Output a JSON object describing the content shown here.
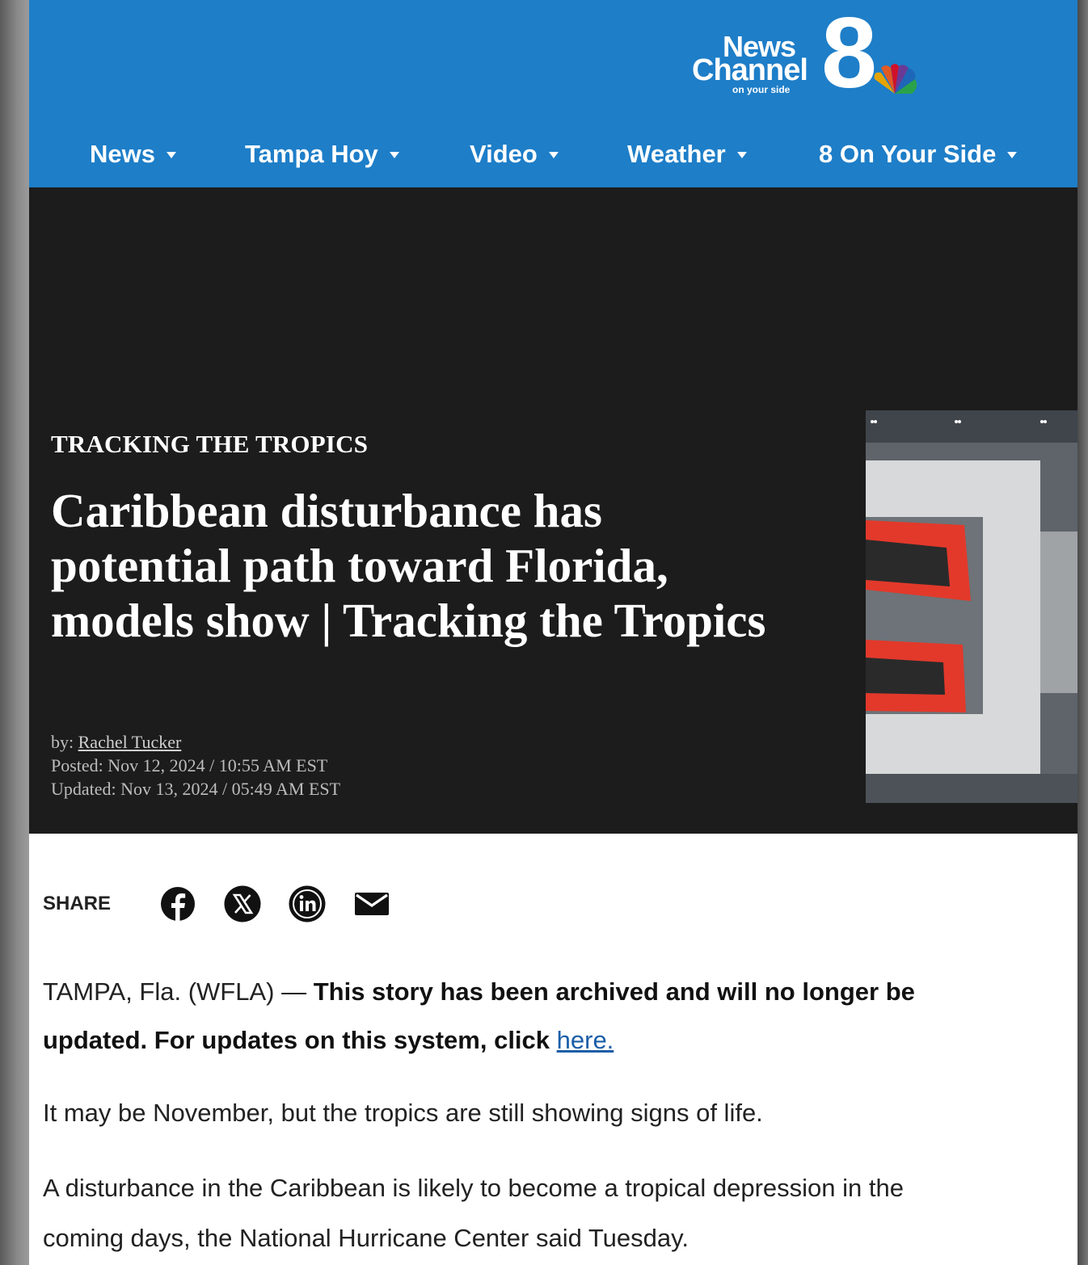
{
  "brand": {
    "line1": "News",
    "line2": "Channel",
    "tagline": "on your side",
    "number": "8",
    "header_color": "#1e7ec8"
  },
  "nav": {
    "items": [
      {
        "label": "News"
      },
      {
        "label": "Tampa Hoy"
      },
      {
        "label": "Video"
      },
      {
        "label": "Weather"
      },
      {
        "label": "8 On Your Side"
      }
    ]
  },
  "article": {
    "kicker": "TRACKING THE TROPICS",
    "headline": "Caribbean disturbance has potential path toward Florida, models show | Tracking the Tropics",
    "byline_prefix": "by: ",
    "author": "Rachel Tucker",
    "posted": "Posted: Nov 12, 2024 / 10:55 AM EST",
    "updated": "Updated: Nov 13, 2024 / 05:49 AM EST"
  },
  "share": {
    "label": "SHARE",
    "icons": [
      "facebook-icon",
      "x-icon",
      "linkedin-icon",
      "email-icon"
    ]
  },
  "body": {
    "dateline": "TAMPA, Fla. (WFLA) — ",
    "archived_notice": "This story has been archived and will no longer be updated. For updates on this system, click ",
    "link_text": "here.",
    "paragraph2": "It may be November, but the tropics are still showing signs of life.",
    "paragraph3": "A disturbance in the Caribbean is likely to become a tropical depression in the coming days, the National Hurricane Center said Tuesday."
  }
}
